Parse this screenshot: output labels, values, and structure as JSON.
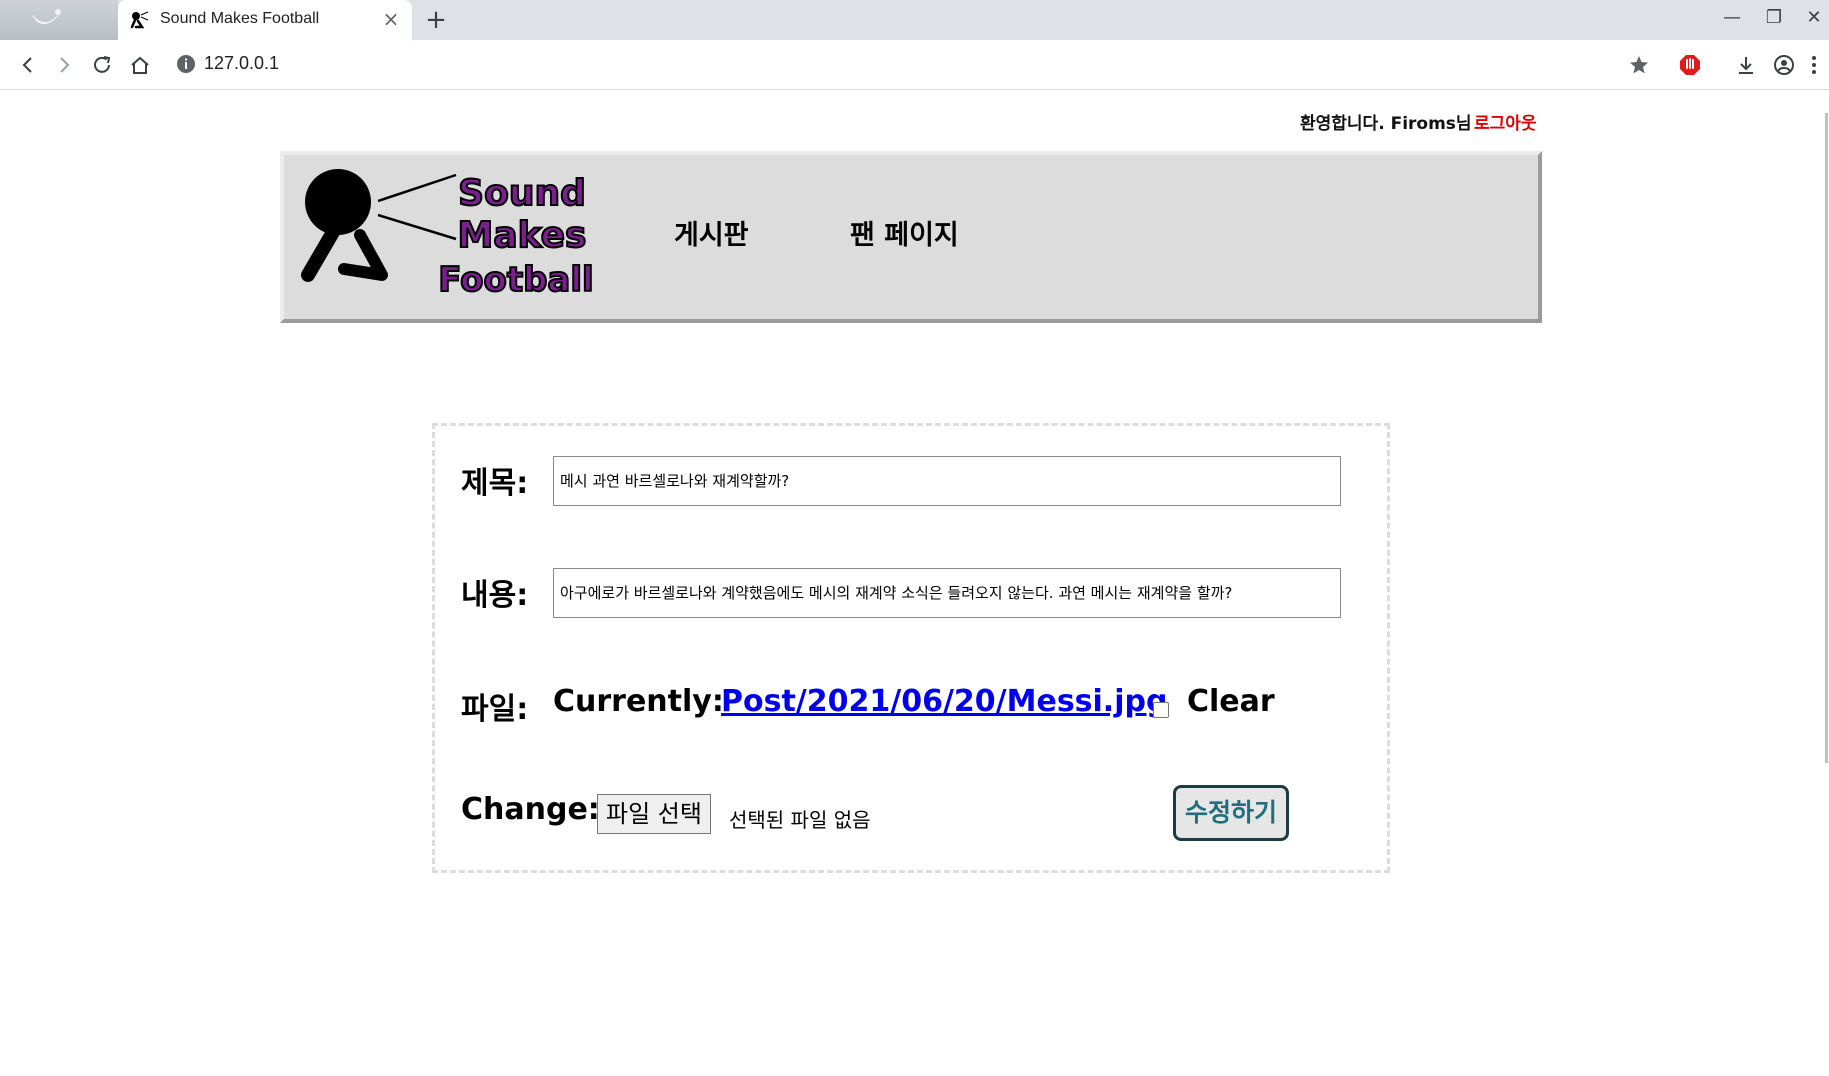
{
  "browser": {
    "tab_title": "Sound Makes Football",
    "tab_close": "×",
    "new_tab": "+",
    "url": "127.0.0.1",
    "window_controls": [
      "—",
      "❐",
      "✕"
    ]
  },
  "page": {
    "welcome": "환영합니다. Firoms님",
    "logout": "로그아웃",
    "logo_text": [
      "Sound",
      "Makes",
      "Football"
    ],
    "nav": [
      "게시판",
      "팬 페이지"
    ]
  },
  "form": {
    "title_label": "제목:",
    "title_value": "메시 과연 바르셀로나와 재계약할까?",
    "content_label": "내용:",
    "content_value": "아구에로가 바르셀로나와 계약했음에도 메시의 재계약 소식은 들려오지 않는다. 과연 메시는 재계약을 할까?",
    "file_label": "파일:",
    "currently_label": "Currently:",
    "current_file": "Post/2021/06/20/Messi.jpg",
    "clear_label": "Clear",
    "change_label": "Change:",
    "choose_file": "파일 선택",
    "no_file": "선택된 파일 없음",
    "submit": "수정하기"
  },
  "colors": {
    "header_bg": "#dcdcdc",
    "logout": "#e00000",
    "link": "#0000ee",
    "submit_text": "#1f6f7c",
    "logo_text": "#7a1f8c"
  }
}
